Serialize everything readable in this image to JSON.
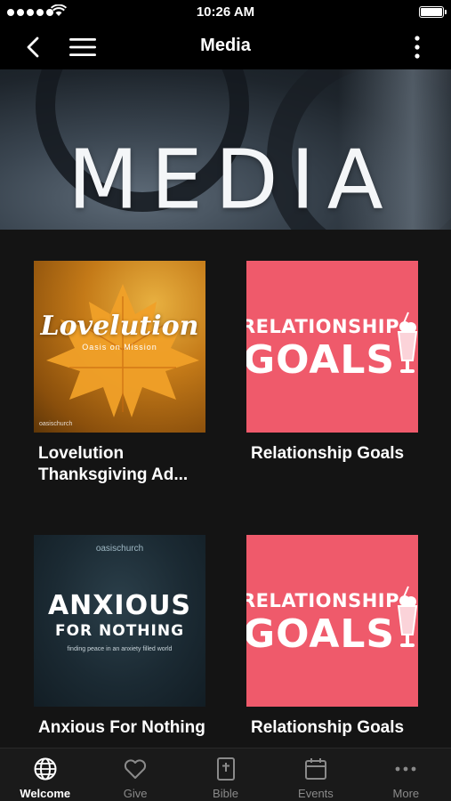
{
  "status": {
    "time": "10:26 AM"
  },
  "nav": {
    "title": "Media"
  },
  "hero": {
    "title": "MEDIA"
  },
  "items": [
    {
      "label": "Lovelution Thanksgiving Ad...",
      "art_title": "Lovelution",
      "art_subtitle": "Oasis on Mission",
      "art_brand": "oasischurch"
    },
    {
      "label": "Relationship Goals",
      "art_line1": "RELATIONSHIP",
      "art_line2": "GOALS"
    },
    {
      "label": "Anxious For Nothing",
      "art_brand": "oasischurch",
      "art_line1": "ANXIOUS",
      "art_line2": "FOR NOTHING",
      "art_tagline": "finding peace in an anxiety filled world"
    },
    {
      "label": "Relationship Goals",
      "art_line1": "RELATIONSHIP",
      "art_line2": "GOALS"
    }
  ],
  "tabs": [
    {
      "label": "Welcome",
      "icon": "globe-icon",
      "active": true
    },
    {
      "label": "Give",
      "icon": "heart-icon"
    },
    {
      "label": "Bible",
      "icon": "bible-icon"
    },
    {
      "label": "Events",
      "icon": "calendar-icon"
    },
    {
      "label": "More",
      "icon": "ellipsis-icon"
    }
  ],
  "colors": {
    "accent_pink": "#ef5a6b",
    "background": "#141414",
    "bar": "#000000"
  }
}
